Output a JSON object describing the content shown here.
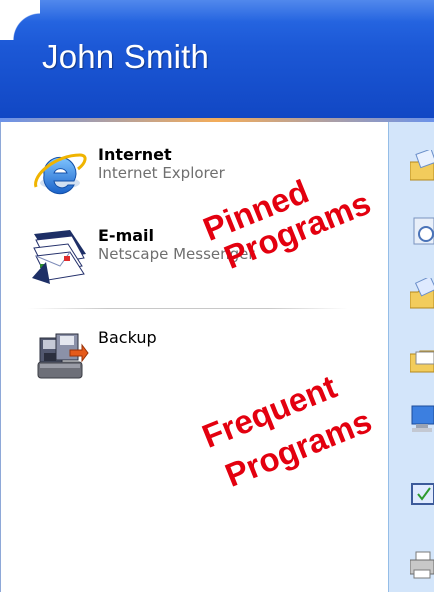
{
  "header": {
    "user_name": "John Smith"
  },
  "pinned": [
    {
      "title": "Internet",
      "subtitle": "Internet Explorer",
      "icon": "internet-explorer-icon"
    },
    {
      "title": "E-mail",
      "subtitle": "Netscape Messenger",
      "icon": "email-envelopes-icon"
    }
  ],
  "frequent": [
    {
      "label": "Backup",
      "icon": "backup-drive-icon"
    }
  ],
  "annotations": {
    "pinned_line1": "Pinned",
    "pinned_line2": "Programs",
    "frequent_line1": "Frequent",
    "frequent_line2": "Programs"
  },
  "right_pane_icons": [
    "my-documents-folder-icon",
    "my-recent-documents-icon",
    "my-pictures-folder-icon",
    "my-music-folder-icon",
    "my-computer-icon",
    "control-panel-icon",
    "printers-icon"
  ],
  "colors": {
    "header_blue": "#1c58d6",
    "annotation_red": "#e3000f",
    "right_pane_blue": "#d3e5fa"
  }
}
